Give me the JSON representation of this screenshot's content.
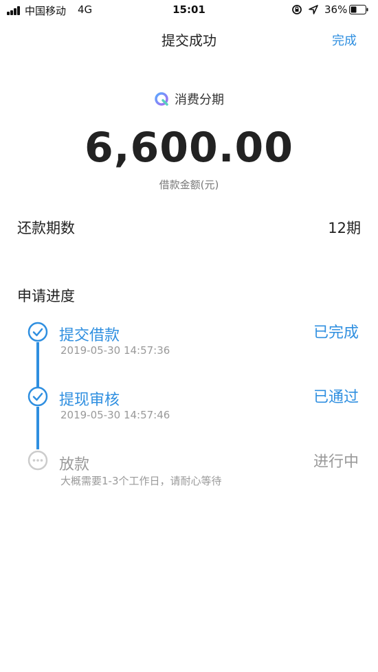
{
  "status_bar": {
    "carrier": "中国移动",
    "network": "4G",
    "time": "15:01",
    "battery": "36%"
  },
  "nav": {
    "title": "提交成功",
    "done_label": "完成"
  },
  "product": {
    "name": "消费分期",
    "icon": "product-logo-icon"
  },
  "loan": {
    "amount": "6,600.00",
    "amount_label": "借款金额(元)",
    "term_label": "还款期数",
    "term_value": "12期"
  },
  "progress": {
    "title": "申请进度",
    "steps": [
      {
        "title": "提交借款",
        "subtitle": "2019-05-30 14:57:36",
        "status": "已完成",
        "state": "done"
      },
      {
        "title": "提现审核",
        "subtitle": "2019-05-30 14:57:46",
        "status": "已通过",
        "state": "done"
      },
      {
        "title": "放款",
        "subtitle": "大概需要1-3个工作日，请耐心等待",
        "status": "进行中",
        "state": "pending"
      }
    ]
  },
  "colors": {
    "accent": "#2f8fe0",
    "muted": "#999999",
    "text": "#222222"
  }
}
